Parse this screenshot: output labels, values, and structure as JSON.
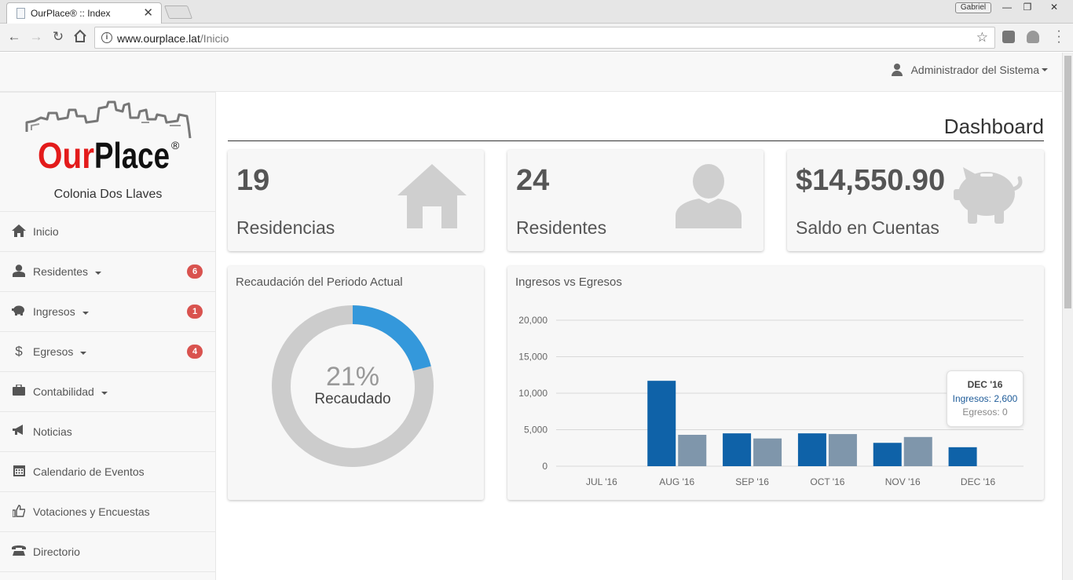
{
  "browser": {
    "tab_title": "OurPlace® :: Index",
    "tab_close": "✕",
    "profile": "Gabriel",
    "url_host": "www.ourplace.lat",
    "url_path": "/Inicio"
  },
  "topbar": {
    "user_name": "Administrador del Sistema"
  },
  "sidebar": {
    "logo_text": "OurPlace",
    "logo_mark": "®",
    "colony": "Colonia Dos Llaves",
    "items": [
      {
        "label": "Inicio",
        "icon": "home-icon",
        "has_caret": false,
        "badge": ""
      },
      {
        "label": "Residentes",
        "icon": "user-icon",
        "has_caret": true,
        "badge": "6"
      },
      {
        "label": "Ingresos",
        "icon": "piggy-bank-icon",
        "has_caret": true,
        "badge": "1"
      },
      {
        "label": "Egresos",
        "icon": "dollar-icon",
        "has_caret": true,
        "badge": "4"
      },
      {
        "label": "Contabilidad",
        "icon": "briefcase-icon",
        "has_caret": true,
        "badge": ""
      },
      {
        "label": "Noticias",
        "icon": "bullhorn-icon",
        "has_caret": false,
        "badge": ""
      },
      {
        "label": "Calendario de Eventos",
        "icon": "calendar-icon",
        "has_caret": false,
        "badge": ""
      },
      {
        "label": "Votaciones y Encuestas",
        "icon": "thumbs-up-icon",
        "has_caret": false,
        "badge": ""
      },
      {
        "label": "Directorio",
        "icon": "phone-icon",
        "has_caret": false,
        "badge": ""
      }
    ]
  },
  "main": {
    "title": "Dashboard",
    "stats": [
      {
        "value": "19",
        "label": "Residencias",
        "icon": "house-icon"
      },
      {
        "value": "24",
        "label": "Residentes",
        "icon": "person-icon"
      },
      {
        "value": "$14,550.90",
        "label": "Saldo en Cuentas",
        "icon": "piggy-bank-icon"
      }
    ],
    "donut_panel": {
      "title": "Recaudación del Periodo Actual",
      "percent": "21%",
      "percent_value": 21,
      "label": "Recaudado"
    },
    "chart_panel": {
      "title": "Ingresos vs Egresos",
      "tooltip": {
        "header": "DEC '16",
        "ingresos": "Ingresos: 2,600",
        "egresos": "Egresos: 0"
      }
    }
  },
  "colors": {
    "ingresos": "#0f62a8",
    "egresos": "#7f96ab",
    "donut_fill": "#3498db",
    "donut_track": "#cccccc",
    "badge": "#d9534f"
  },
  "chart_data": {
    "type": "bar",
    "categories": [
      "JUL '16",
      "AUG '16",
      "SEP '16",
      "OCT '16",
      "NOV '16",
      "DEC '16"
    ],
    "series": [
      {
        "name": "Ingresos",
        "values": [
          0,
          11700,
          4500,
          4500,
          3200,
          2600
        ]
      },
      {
        "name": "Egresos",
        "values": [
          0,
          4300,
          3800,
          4400,
          4000,
          0
        ]
      }
    ],
    "yticks": [
      "20,000",
      "15,000",
      "10,000",
      "5,000",
      "0"
    ],
    "ylim": [
      0,
      20000
    ],
    "grid": true
  }
}
